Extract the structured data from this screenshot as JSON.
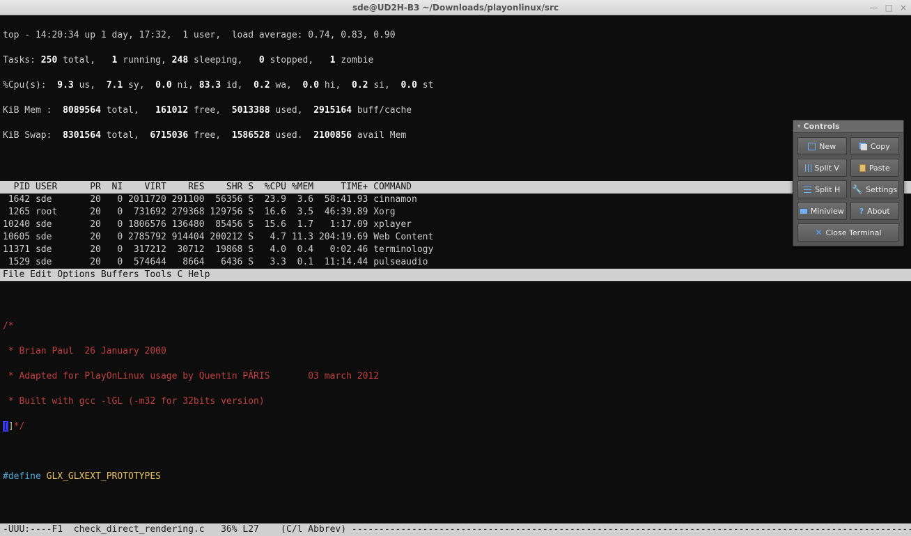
{
  "window": {
    "title": "sde@UD2H-B3 ~/Downloads/playonlinux/src"
  },
  "top": {
    "line1": "top - 14:20:34 up 1 day, 17:32,  1 user,  load average: 0.74, 0.83, 0.90",
    "tasks_prefix": "Tasks:",
    "tasks_total": " 250 ",
    "tasks_total_lbl": "total,",
    "tasks_running": "   1 ",
    "tasks_running_lbl": "running,",
    "tasks_sleeping": " 248 ",
    "tasks_sleeping_lbl": "sleeping,",
    "tasks_stopped": "   0 ",
    "tasks_stopped_lbl": "stopped,",
    "tasks_zombie": "   1 ",
    "tasks_zombie_lbl": "zombie",
    "cpu_prefix": "%Cpu(s):",
    "cpu_us": "  9.3 ",
    "cpu_us_lbl": "us,",
    "cpu_sy": "  7.1 ",
    "cpu_sy_lbl": "sy,",
    "cpu_ni": "  0.0 ",
    "cpu_ni_lbl": "ni,",
    "cpu_id": " 83.3 ",
    "cpu_id_lbl": "id,",
    "cpu_wa": "  0.2 ",
    "cpu_wa_lbl": "wa,",
    "cpu_hi": "  0.0 ",
    "cpu_hi_lbl": "hi,",
    "cpu_si": "  0.2 ",
    "cpu_si_lbl": "si,",
    "cpu_st": "  0.0 ",
    "cpu_st_lbl": "st",
    "mem_prefix": "KiB Mem :",
    "mem_total": "  8089564 ",
    "mem_total_lbl": "total,",
    "mem_free": "   161012 ",
    "mem_free_lbl": "free,",
    "mem_used": "  5013388 ",
    "mem_used_lbl": "used,",
    "mem_buff": "  2915164 ",
    "mem_buff_lbl": "buff/cache",
    "swap_prefix": "KiB Swap:",
    "swap_total": "  8301564 ",
    "swap_total_lbl": "total,",
    "swap_free": "  6715036 ",
    "swap_free_lbl": "free,",
    "swap_used": "  1586528 ",
    "swap_used_lbl": "used.",
    "swap_avail": "  2100856 ",
    "swap_avail_lbl": "avail Mem"
  },
  "columns": "  PID USER      PR  NI    VIRT    RES    SHR S  %CPU %MEM     TIME+ COMMAND",
  "processes": [
    " 1642 sde       20   0 2011720 291100  56356 S  23.9  3.6  58:41.93 cinnamon",
    " 1265 root      20   0  731692 279368 129756 S  16.6  3.5  46:39.89 Xorg",
    "10240 sde       20   0 1806576 136480  85456 S  15.6  1.7   1:17.09 xplayer",
    "10605 sde       20   0 2785792 914404 200212 S   4.7 11.3 204:19.69 Web Content",
    "11371 sde       20   0  317212  30712  19868 S   4.0  0.4   0:02.46 terminology",
    " 1529 sde       20   0  574644   8664   6436 S   3.3  0.1  11:14.44 pulseaudio"
  ],
  "emacs_menu": "File Edit Options Buffers Tools C Help",
  "code": {
    "l1": "/*",
    "l2": " * Brian Paul  26 January 2000",
    "l3a": " * Adapted for PlayOnLinux usage by Quentin PÂRIS       ",
    "l3b": "03 march 2012",
    "l4": " * Built with gcc -lGL (-m32 for 32bits version)",
    "l5a": "[",
    "l5b": "]",
    "l5c": "*/",
    "l6a": "#define",
    "l6b": " GLX_GLXEXT_PROTOTYPES"
  },
  "status": "-UUU:----F1  check_direct_rendering.c   36% L27    (C/l Abbrev) --------------------------------------------------------------------------------------------------------------",
  "panel": {
    "title": "Controls",
    "new": "New",
    "copy": "Copy",
    "splitv": "Split V",
    "paste": "Paste",
    "splith": "Split H",
    "settings": "Settings",
    "miniview": "Miniview",
    "about": "About",
    "close": "Close Terminal"
  }
}
